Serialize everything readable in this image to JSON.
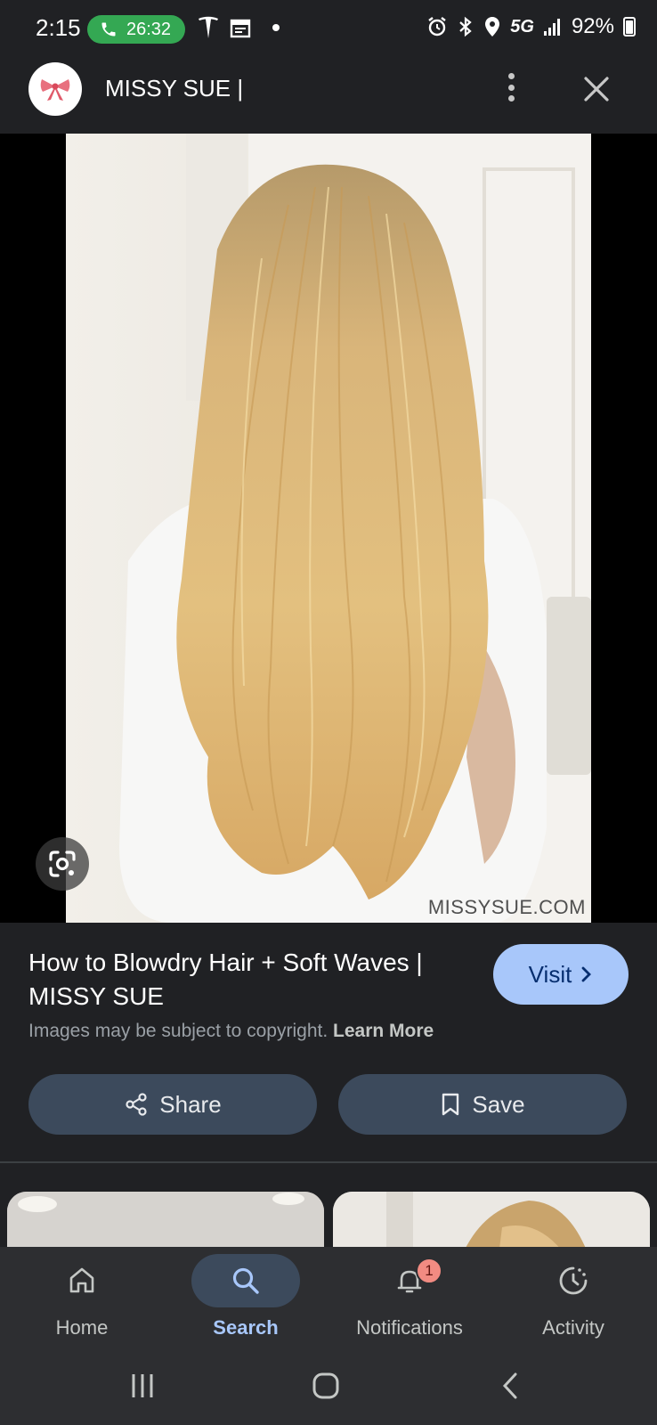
{
  "status_bar": {
    "time": "2:15",
    "call_timer": "26:32",
    "network": "5G",
    "battery": "92%"
  },
  "header": {
    "site_name": "MISSY SUE |"
  },
  "image": {
    "watermark": "MISSYSUE.COM"
  },
  "result": {
    "title": "How to Blowdry Hair + Soft Waves | MISSY SUE",
    "visit_label": "Visit",
    "copyright_text": "Images may be subject to copyright.",
    "learn_more": "Learn More",
    "share_label": "Share",
    "save_label": "Save"
  },
  "bottom_nav": {
    "items": [
      {
        "label": "Home",
        "icon": "home-icon"
      },
      {
        "label": "Search",
        "icon": "search-icon",
        "active": true
      },
      {
        "label": "Notifications",
        "icon": "bell-icon",
        "badge": "1"
      },
      {
        "label": "Activity",
        "icon": "activity-icon"
      }
    ]
  },
  "colors": {
    "background": "#202124",
    "accent": "#a8c7fa",
    "pill": "#3c4a5c",
    "call_green": "#34a853",
    "badge": "#f28b82"
  }
}
